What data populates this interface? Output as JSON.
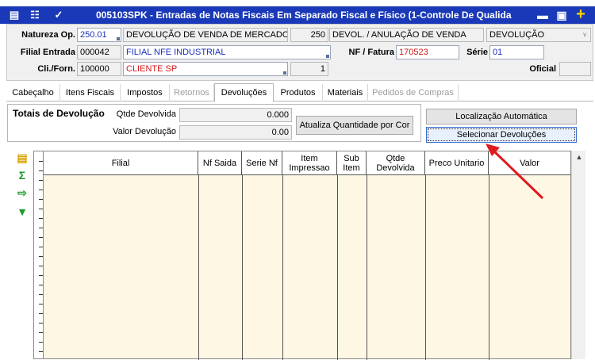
{
  "window": {
    "title": "005103SPK - Entradas de Notas Fiscais Em Separado Fiscal e Físico (1-Controle De Qualida",
    "icons": [
      "list-icon",
      "tree-icon",
      "wrench-icon"
    ]
  },
  "header": {
    "natureza_label": "Natureza Op.",
    "natureza_code": "250.01",
    "natureza_desc": "DEVOLUÇÃO DE VENDA DE MERCADORIA",
    "natureza_num": "250",
    "natureza_desc2": "DEVOL. / ANULAÇÃO DE VENDA",
    "natureza_type": "DEVOLUÇÃO",
    "filial_label": "Filial Entrada",
    "filial_code": "000042",
    "filial_desc": "FILIAL NFE INDUSTRIAL",
    "nf_label": "NF / Fatura",
    "nf_value": "170523",
    "serie_label": "Série",
    "serie_value": "01",
    "cli_label": "Cli./Forn.",
    "cli_code": "100000",
    "cli_desc": "CLIENTE SP",
    "cli_num": "1",
    "oficial_label": "Oficial",
    "oficial_value": ""
  },
  "tabs": [
    {
      "label": "Cabeçalho",
      "state": "normal"
    },
    {
      "label": "Itens Fiscais",
      "state": "normal"
    },
    {
      "label": "Impostos",
      "state": "normal"
    },
    {
      "label": "Retornos",
      "state": "disabled"
    },
    {
      "label": "Devoluções",
      "state": "active"
    },
    {
      "label": "Produtos",
      "state": "normal"
    },
    {
      "label": "Materiais",
      "state": "normal"
    },
    {
      "label": "Pedidos de Compras",
      "state": "disabled"
    }
  ],
  "totals": {
    "title": "Totais de Devolução",
    "qtde_label": "Qtde Devolvida",
    "qtde_value": "0.000",
    "valor_label": "Valor Devolução",
    "valor_value": "0.00",
    "atualiza_button": "Atualiza Quantidade por Cor"
  },
  "actions": {
    "localizacao_button": "Localização Automática",
    "selecionar_button": "Selecionar Devoluções"
  },
  "grid": {
    "columns": [
      "Filial",
      "Nf Saida",
      "Serie Nf",
      "Item Impressao",
      "Sub Item",
      "Qtde Devolvida",
      "Preco Unitario",
      "Valor"
    ],
    "rows": []
  },
  "colors": {
    "title_bar": "#1a39b8",
    "grid_bg": "#fdf7e3",
    "annotation_arrow": "#e0191d"
  }
}
